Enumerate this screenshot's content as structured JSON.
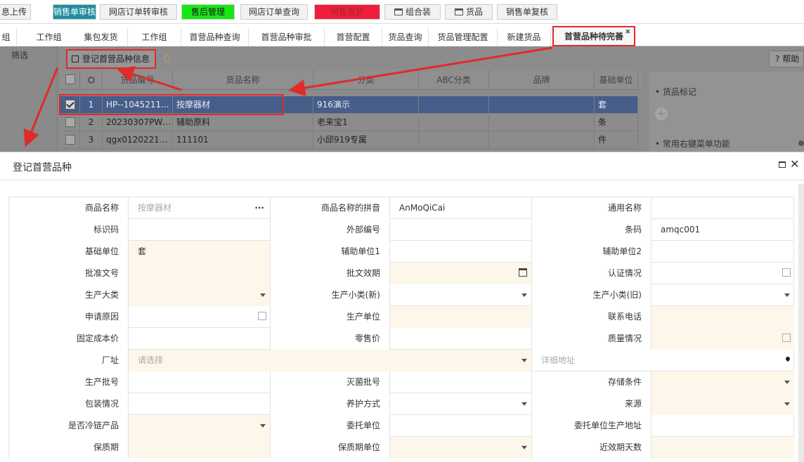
{
  "top_tabs": [
    {
      "label": "息上传",
      "bg": "#f2f2f2",
      "color": "#333"
    },
    {
      "label": "销售单审核",
      "bg": "#1f8e9e",
      "color": "#ffffff"
    },
    {
      "label": "网店订单转审核",
      "bg": "#f2f2f2",
      "color": "#333"
    },
    {
      "label": "售后管理",
      "bg": "#19e619",
      "color": "#1a1a1a"
    },
    {
      "label": "网店订单查询",
      "bg": "#f2f2f2",
      "color": "#333"
    },
    {
      "label": "销售发货",
      "bg": "#ef1f3c",
      "color": "#9e2a2a"
    },
    {
      "label": "组合装",
      "bg": "#f2f2f2",
      "color": "#333",
      "icon": "folder-icon"
    },
    {
      "label": "货品",
      "bg": "#f2f2f2",
      "color": "#333",
      "icon": "folder-icon"
    },
    {
      "label": "销售单复核",
      "bg": "#f2f2f2",
      "color": "#333"
    }
  ],
  "sub_tabs": [
    "组",
    "工作组",
    "集包发货",
    "工作组",
    "首营品种查询",
    "首营品种审批",
    "首营配置",
    "货品查询",
    "货品管理配置",
    "新建货品",
    "首营品种待完善"
  ],
  "toolbar": {
    "filter": "筛选",
    "register_button": "登记首营品种信息",
    "help_button": "帮助",
    "help_mark": "?"
  },
  "grid": {
    "headers": [
      "货品编号",
      "货品名称",
      "分类",
      "ABC分类",
      "品牌",
      "基础单位"
    ],
    "rows": [
      {
        "no": "1",
        "code": "HP--1045211...",
        "name": "按摩器材",
        "category": "916演示",
        "abc": "",
        "brand": "",
        "unit": "套",
        "selected": true
      },
      {
        "no": "2",
        "code": "20230307PWJ...",
        "name": "辅助原料",
        "category": "老来宝1",
        "abc": "",
        "brand": "",
        "unit": "条",
        "selected": false
      },
      {
        "no": "3",
        "code": "qgx0120221x...",
        "name": "111101",
        "category": "小邱919专属",
        "abc": "",
        "brand": "",
        "unit": "件",
        "selected": false
      }
    ]
  },
  "right_panel": {
    "item1": "货品标记",
    "item2": "常用右键菜单功能",
    "plus": "+"
  },
  "dialog": {
    "title": "登记首营品种",
    "close": "✕"
  },
  "form": {
    "rows": [
      [
        {
          "label": "商品名称",
          "value": "按摩器材",
          "type": "lookup",
          "style": "readonly"
        },
        {
          "label": "商品名称的拼音",
          "value": "AnMoQiCai",
          "type": "text"
        },
        {
          "label": "通用名称",
          "value": "",
          "type": "text"
        }
      ],
      [
        {
          "label": "标识码",
          "value": "",
          "type": "text"
        },
        {
          "label": "外部编号",
          "value": "",
          "type": "text"
        },
        {
          "label": "条码",
          "value": "amqc001",
          "type": "text"
        }
      ],
      [
        {
          "label": "基础单位",
          "value": "套",
          "type": "text",
          "required": true
        },
        {
          "label": "辅助单位1",
          "value": "",
          "type": "text"
        },
        {
          "label": "辅助单位2",
          "value": "",
          "type": "text"
        }
      ],
      [
        {
          "label": "批准文号",
          "value": "",
          "type": "text",
          "required": true
        },
        {
          "label": "批文效期",
          "value": "",
          "type": "date",
          "required": true
        },
        {
          "label": "认证情况",
          "value": "",
          "type": "editor"
        }
      ],
      [
        {
          "label": "生产大类",
          "value": "",
          "type": "select",
          "required": true
        },
        {
          "label": "生产小类(新)",
          "value": "",
          "type": "select"
        },
        {
          "label": "生产小类(旧)",
          "value": "",
          "type": "select"
        }
      ],
      [
        {
          "label": "申请原因",
          "value": "",
          "type": "editor"
        },
        {
          "label": "生产单位",
          "value": "",
          "type": "text",
          "required": true
        },
        {
          "label": "联系电话",
          "value": "",
          "type": "text",
          "required": true
        }
      ],
      [
        {
          "label": "固定成本价",
          "value": "",
          "type": "text"
        },
        {
          "label": "零售价",
          "value": "",
          "type": "text"
        },
        {
          "label": "质量情况",
          "value": "",
          "type": "editor",
          "required": true
        }
      ],
      [
        {
          "label": "厂址",
          "value": "请选择",
          "type": "select-wide",
          "required": true,
          "placeholder": true
        },
        {
          "label": "",
          "value": "详细地址",
          "type": "address",
          "placeholder": true
        }
      ],
      [
        {
          "label": "生产批号",
          "value": "",
          "type": "text"
        },
        {
          "label": "灭菌批号",
          "value": "",
          "type": "text"
        },
        {
          "label": "存储条件",
          "value": "",
          "type": "select",
          "required": true
        }
      ],
      [
        {
          "label": "包装情况",
          "value": "",
          "type": "text"
        },
        {
          "label": "养护方式",
          "value": "",
          "type": "select"
        },
        {
          "label": "来源",
          "value": "",
          "type": "select",
          "required": true
        }
      ],
      [
        {
          "label": "是否冷链产品",
          "value": "",
          "type": "select",
          "required": true
        },
        {
          "label": "委托单位",
          "value": "",
          "type": "text"
        },
        {
          "label": "委托单位生产地址",
          "value": "",
          "type": "text"
        }
      ],
      [
        {
          "label": "保质期",
          "value": "",
          "type": "text",
          "required": true
        },
        {
          "label": "保质期单位",
          "value": "",
          "type": "select",
          "required": true
        },
        {
          "label": "近效期天数",
          "value": "",
          "type": "text",
          "required": true
        }
      ]
    ]
  }
}
